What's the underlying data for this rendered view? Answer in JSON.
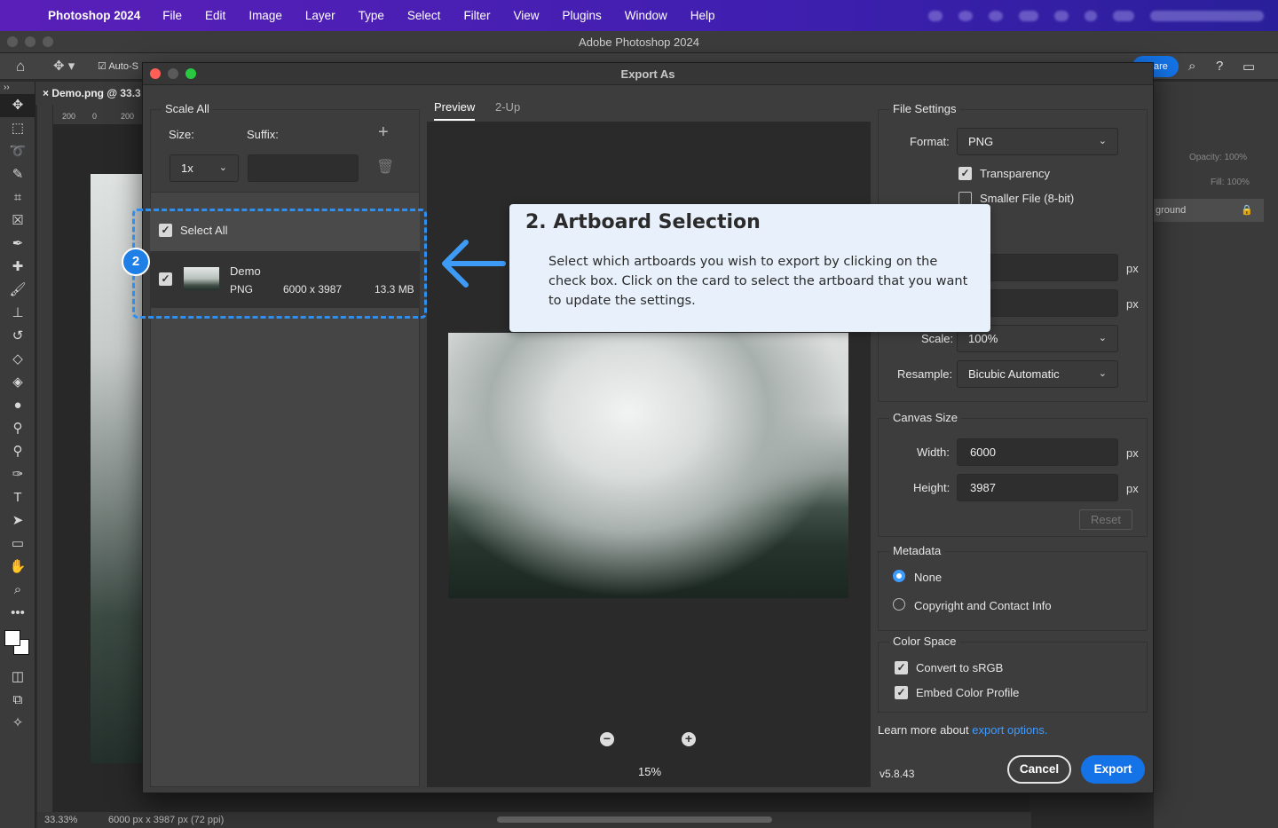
{
  "menubar": {
    "app_name": "Photoshop 2024",
    "items": [
      "File",
      "Edit",
      "Image",
      "Layer",
      "Type",
      "Select",
      "Filter",
      "View",
      "Plugins",
      "Window",
      "Help"
    ]
  },
  "ps_window": {
    "title": "Adobe Photoshop 2024",
    "option_autoselect": "Auto-S",
    "share_label": "are",
    "doc_tab": "Demo.png @ 33.3",
    "ruler_ticks": [
      "200",
      "0",
      "200"
    ],
    "zoom_status": "33.33%",
    "doc_info": "6000 px x 3987 px (72 ppi)",
    "layers_panel": {
      "opacity_label": "Opacity:",
      "opacity_value": "100%",
      "fill_label": "Fill:",
      "fill_value": "100%",
      "layer_name": "ground"
    }
  },
  "dialog": {
    "title": "Export As",
    "scale_all": {
      "legend": "Scale All",
      "size_label": "Size:",
      "suffix_label": "Suffix:",
      "size_value": "1x",
      "suffix_value": ""
    },
    "select_all_label": "Select All",
    "artboard": {
      "name": "Demo",
      "format": "PNG",
      "dimensions": "6000 x 3987",
      "filesize": "13.3 MB"
    },
    "preview_tabs": [
      "Preview",
      "2-Up"
    ],
    "zoom_value": "15%",
    "file_settings": {
      "legend": "File Settings",
      "format_label": "Format:",
      "format_value": "PNG",
      "transparency_label": "Transparency",
      "smaller_file_label": "Smaller File (8-bit)",
      "width_value_partial": "0",
      "height_value_partial": "7",
      "px": "px",
      "scale_label": "Scale:",
      "scale_value": "100%",
      "resample_label": "Resample:",
      "resample_value": "Bicubic Automatic"
    },
    "canvas_size": {
      "legend": "Canvas Size",
      "width_label": "Width:",
      "width_value": "6000",
      "height_label": "Height:",
      "height_value": "3987",
      "reset_label": "Reset"
    },
    "metadata": {
      "legend": "Metadata",
      "none_label": "None",
      "copyright_label": "Copyright and Contact Info"
    },
    "color_space": {
      "legend": "Color Space",
      "srgb_label": "Convert to sRGB",
      "embed_label": "Embed Color Profile"
    },
    "learn_more_prefix": "Learn more about",
    "learn_more_link": "export options.",
    "version": "v5.8.43",
    "cancel_label": "Cancel",
    "export_label": "Export"
  },
  "callout": {
    "badge": "2",
    "title": "2. Artboard Selection",
    "body": "Select which artboards you wish to export by clicking on the check box. Click on the card to select the artboard that you want to update the settings."
  },
  "colors": {
    "accent": "#1473e6",
    "callout_bg": "#e8f1fb",
    "highlight_dash": "#2f8ff0",
    "menubar": "#4b1fb5"
  }
}
